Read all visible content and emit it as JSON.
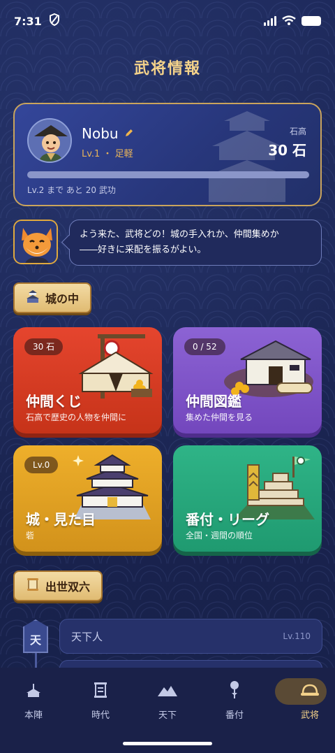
{
  "status_bar": {
    "time": "7:31"
  },
  "header": {
    "title": "武将情報"
  },
  "profile": {
    "name": "Nobu",
    "level_line": "Lv.1 ・ 足軽",
    "koku_label": "石高",
    "koku_value": "30 石",
    "progress_fraction": 0.0,
    "next_level_text": "Lv.2 まで あと 20 武功"
  },
  "mascot": {
    "message_line1": "よう来た、武将どの！城の手入れか、仲間集めか",
    "message_line2": "――好きに采配を振るがよい。"
  },
  "sections": {
    "castle": {
      "label": "城の中",
      "icon": "castle-icon"
    },
    "sugoroku": {
      "label": "出世双六",
      "icon": "scroll-icon"
    }
  },
  "cards": [
    {
      "badge": "30 石",
      "title": "仲間くじ",
      "subtitle": "石高で歴史の人物を仲間に",
      "color": "#d63d24"
    },
    {
      "badge": "0 / 52",
      "title": "仲間図鑑",
      "subtitle": "集めた仲間を見る",
      "color": "#7f55c9"
    },
    {
      "badge": "Lv.0",
      "title": "城・見た目",
      "subtitle": "砦",
      "color": "#e3a224"
    },
    {
      "badge": "",
      "title": "番付・リーグ",
      "subtitle": "全国・週間の順位",
      "color": "#27a87c"
    }
  ],
  "ladder": {
    "piece": "天",
    "row_title": "天下人",
    "row_level": "Lv.110"
  },
  "tabbar": {
    "tabs": [
      {
        "label": "本陣",
        "icon": "camp-icon"
      },
      {
        "label": "時代",
        "icon": "scroll-icon"
      },
      {
        "label": "天下",
        "icon": "mountain-icon"
      },
      {
        "label": "番付",
        "icon": "pin-icon"
      },
      {
        "label": "武将",
        "icon": "helmet-icon"
      }
    ],
    "active": "武将"
  }
}
